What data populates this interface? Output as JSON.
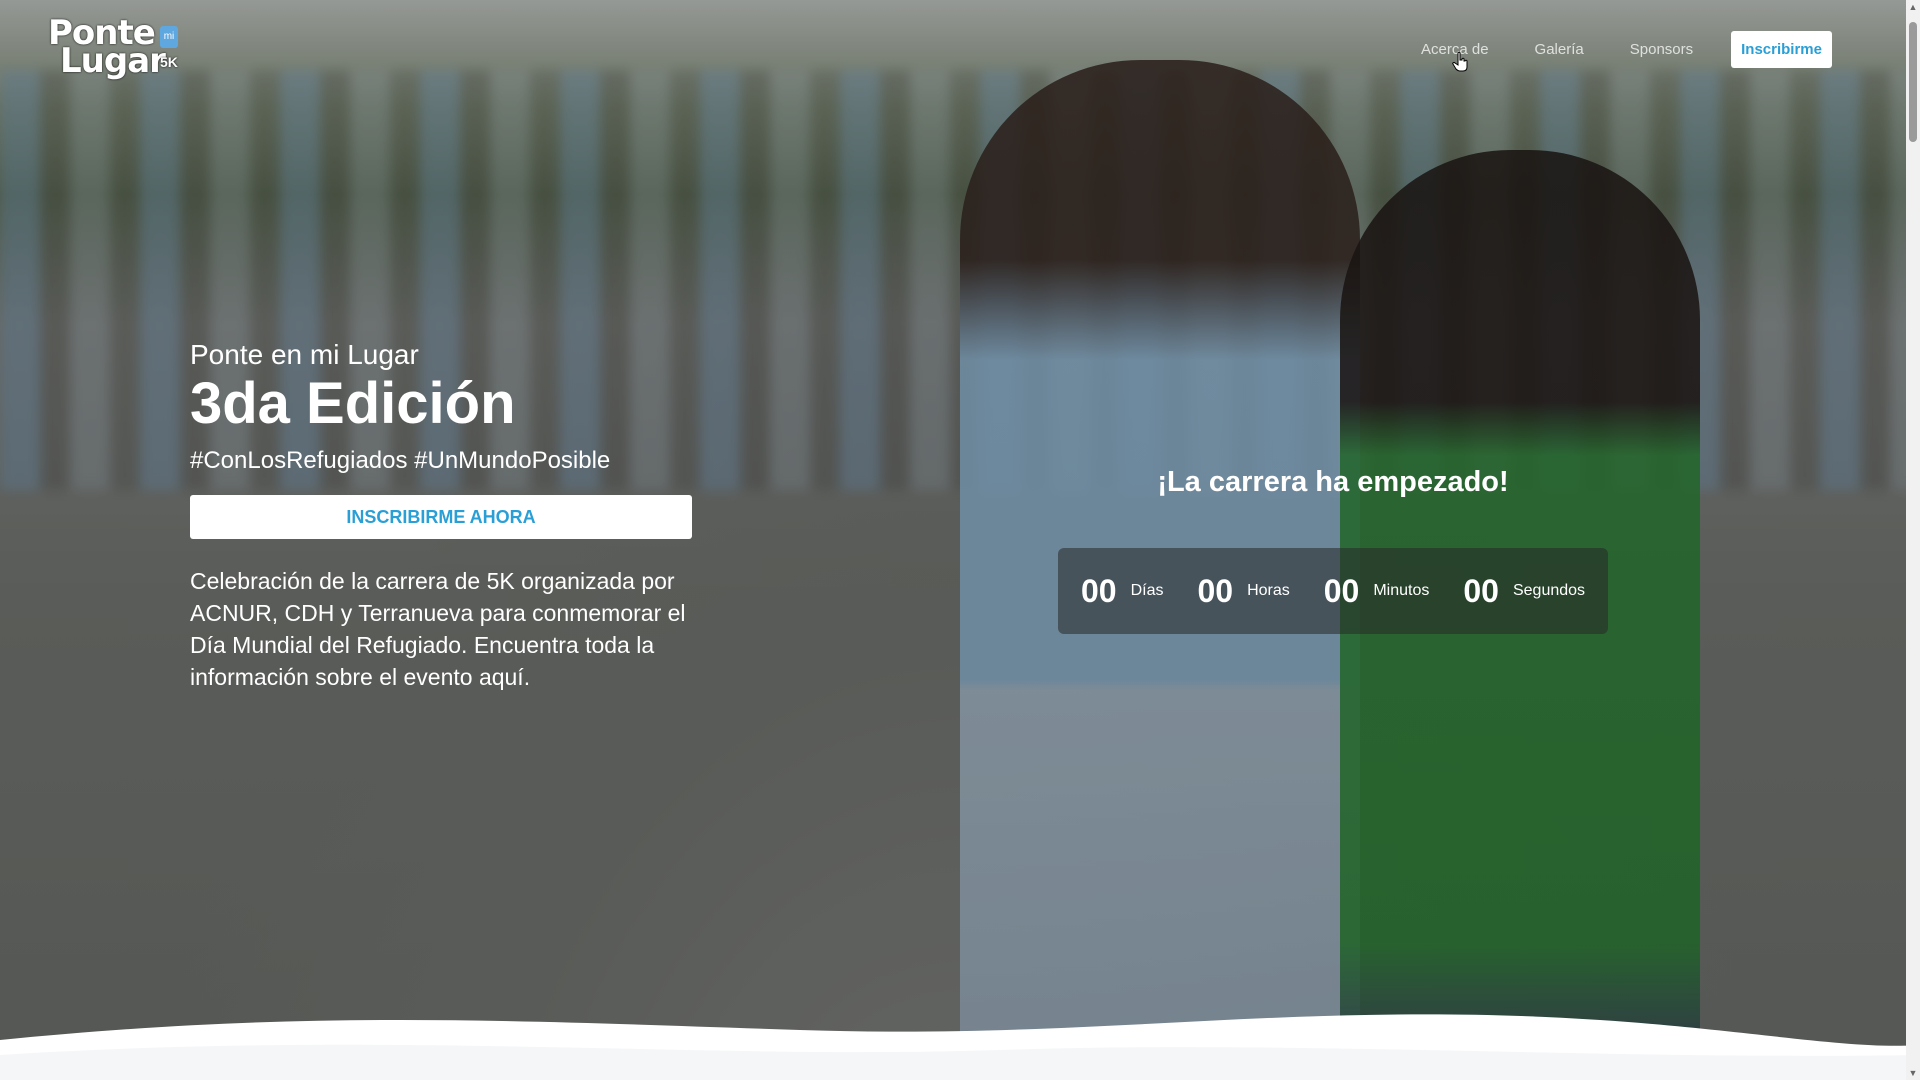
{
  "header": {
    "logo": {
      "line1": "Ponte",
      "line2": "Lugar",
      "mi": "mi",
      "badge": "5K"
    },
    "nav": {
      "items": [
        "Acerca de",
        "Galería",
        "Sponsors"
      ],
      "cta": "Inscribirme"
    }
  },
  "hero": {
    "subtitle": "Ponte en mi Lugar",
    "title": "3da Edición",
    "hashtags": "#ConLosRefugiados #UnMundoPosible",
    "button": "INSCRIBIRME AHORA",
    "description": "Celebración de la carrera de 5K organizada por ACNUR, CDH y Terranueva para conmemorar el Día Mundial del Refugiado. Encuentra toda la información sobre el evento aquí."
  },
  "countdown": {
    "heading": "¡La carrera ha empezado!",
    "units": [
      {
        "value": "00",
        "label": "Días"
      },
      {
        "value": "00",
        "label": "Horas"
      },
      {
        "value": "00",
        "label": "Minutos"
      },
      {
        "value": "00",
        "label": "Segundos"
      }
    ]
  },
  "colors": {
    "accent": "#2a9fd6",
    "white": "#ffffff",
    "countdown_bg": "#282828"
  },
  "icons": {
    "cursor": "hand-pointer-icon",
    "scroll_up": "scroll-up-arrow-icon",
    "scroll_down": "scroll-down-arrow-icon"
  }
}
